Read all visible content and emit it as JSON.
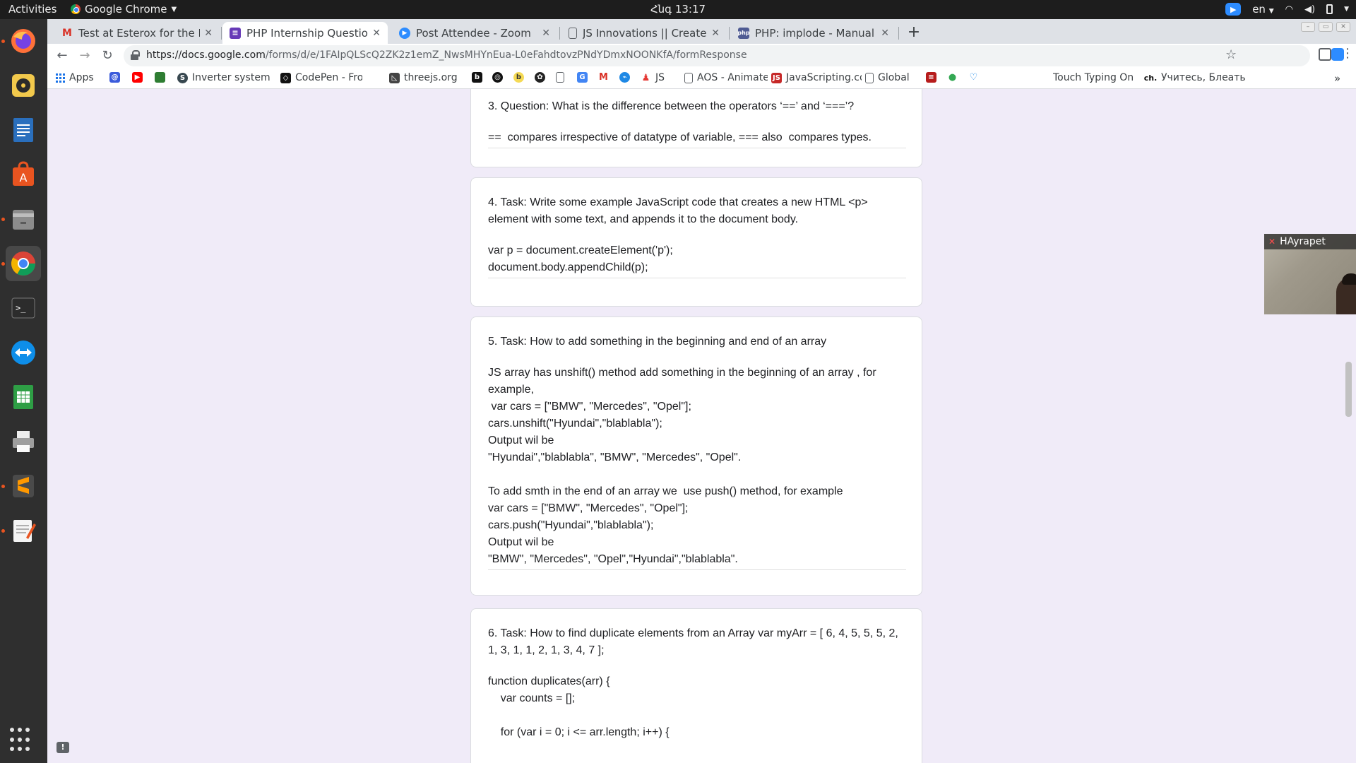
{
  "topbar": {
    "activities": "Activities",
    "app_name": "Google Chrome",
    "clock": "Հնգ 13:17",
    "language": "en"
  },
  "dock": {
    "items": [
      "firefox",
      "rhythmbox",
      "libreoffice-writer",
      "ubuntu-software",
      "files",
      "google-chrome",
      "terminal",
      "teamviewer",
      "libreoffice-calc",
      "printer",
      "sublime-text",
      "text-editor"
    ]
  },
  "tabs": [
    {
      "label": "Test at Esterox for the Int",
      "favicon": "gmail-icon"
    },
    {
      "label": "PHP Internship Question",
      "favicon": "google-forms-icon"
    },
    {
      "label": "Post Attendee - Zoom",
      "favicon": "zoom-icon"
    },
    {
      "label": "JS Innovations || Create M",
      "favicon": "page-icon"
    },
    {
      "label": "PHP: implode - Manual",
      "favicon": "php-icon"
    }
  ],
  "address_bar": {
    "url_host": "https://docs.google.com",
    "url_path": "/forms/d/e/1FAIpQLScQ2ZK2z1emZ_NwsMHYnEua-L0eFahdtovzPNdYDmxNOONKfA/formResponse"
  },
  "bookmarks": [
    {
      "label": "Apps",
      "icon": "apps-grid-icon",
      "color": "#1a73e8"
    },
    {
      "label": "",
      "icon": "at-icon",
      "color": "#3b5bdb"
    },
    {
      "label": "",
      "icon": "youtube-icon",
      "color": "#ff0000"
    },
    {
      "label": "",
      "icon": "image-icon",
      "color": "#2e7d32"
    },
    {
      "label": "Inverter system",
      "icon": "inverter-icon",
      "color": "#37474f"
    },
    {
      "label": "CodePen - Front",
      "icon": "codepen-icon",
      "color": "#111111"
    },
    {
      "label": "threejs.org",
      "icon": "threejs-icon",
      "color": "#444444"
    },
    {
      "label": "",
      "icon": "b-icon",
      "color": "#111111"
    },
    {
      "label": "",
      "icon": "circle-icon",
      "color": "#111111"
    },
    {
      "label": "",
      "icon": "babel-icon",
      "color": "#f5da55"
    },
    {
      "label": "",
      "icon": "openai-icon",
      "color": "#222222"
    },
    {
      "label": "",
      "icon": "page-icon",
      "color": "#5f6368"
    },
    {
      "label": "",
      "icon": "translate-icon",
      "color": "#4285f4"
    },
    {
      "label": "",
      "icon": "gmail-icon",
      "color": "#d93025"
    },
    {
      "label": "",
      "icon": "blue-circle-icon",
      "color": "#1e88e5"
    },
    {
      "label": "JS",
      "icon": "js-figure-icon",
      "color": "#e53935"
    },
    {
      "label": "AOS - Animate o",
      "icon": "page-icon",
      "color": "#5f6368"
    },
    {
      "label": "JavaScripting.co",
      "icon": "javascripting-icon",
      "color": "#c62828"
    },
    {
      "label": "Global",
      "icon": "page-icon",
      "color": "#5f6368"
    },
    {
      "label": "",
      "icon": "red-square-icon",
      "color": "#b71c1c"
    },
    {
      "label": "",
      "icon": "maps-pin-icon",
      "color": "#34a853"
    },
    {
      "label": "",
      "icon": "heart-icon",
      "color": "#1e88e5"
    },
    {
      "label": "Touch Typing On",
      "icon": "",
      "color": ""
    },
    {
      "label": "Учитесь, Блеать",
      "icon": "ch-icon",
      "color": "#111111"
    }
  ],
  "form": {
    "questions": [
      {
        "title": "3. Question: What is the difference between the operators ‘==’ and ‘===’?",
        "answer": [
          "==  compares irrespective of datatype of variable, === also  compares types."
        ]
      },
      {
        "title": "4. Task: Write some example JavaScript code that creates a new HTML <p> element with some text, and appends it to the document body.",
        "answer": [
          "var p = document.createElement('p');",
          "document.body.appendChild(p);"
        ]
      },
      {
        "title": "5. Task: How to add something in the beginning and end of an array",
        "answer": [
          "JS array has unshift() method add something in the beginning of an array , for",
          "example,",
          " var cars = [\"BMW\", \"Mercedes\", \"Opel\"];",
          "cars.unshift(\"Hyundai\",\"blablabla\");",
          "Output wil be",
          "\"Hyundai\",\"blablabla\", \"BMW\", \"Mercedes\", \"Opel\".",
          "",
          "To add smth in the end of an array we  use push() method, for example",
          "var cars = [\"BMW\", \"Mercedes\", \"Opel\"];",
          "cars.push(\"Hyundai\",\"blablabla\");",
          "Output wil be",
          "\"BMW\", \"Mercedes\", \"Opel\",\"Hyundai\",\"blablabla\"."
        ]
      },
      {
        "title": "6. Task: How to find duplicate elements from an Array var myArr = [ 6, 4, 5, 5, 5, 2, 1, 3, 1, 1, 2, 1, 3, 4, 7 ];",
        "answer": [
          "function duplicates(arr) {",
          "    var counts = [];",
          "",
          "    for (var i = 0; i <= arr.length; i++) {"
        ]
      }
    ]
  },
  "zoom_video": {
    "participant_name": "HAyrapet"
  }
}
